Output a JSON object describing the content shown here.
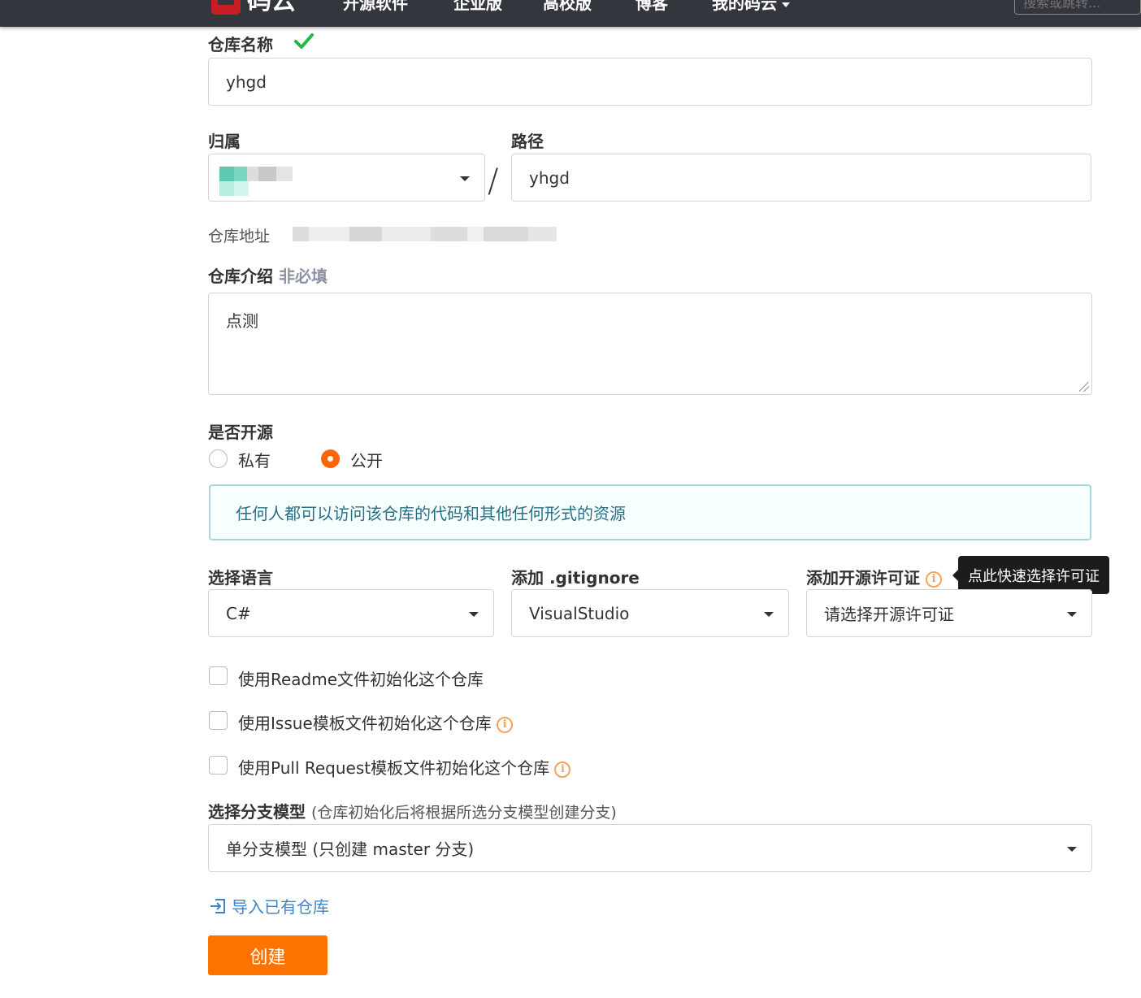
{
  "nav": {
    "logo_text": "码云",
    "items": [
      "开源软件",
      "企业版",
      "高校版",
      "博客",
      "我的码云"
    ],
    "search_placeholder": "搜索或跳转..."
  },
  "form": {
    "repo_name_label": "仓库名称",
    "repo_name_value": "yhgd",
    "owner_label": "归属",
    "path_label": "路径",
    "path_value": "yhgd",
    "path_separator": "/",
    "repo_url_label": "仓库地址",
    "intro_label": "仓库介绍",
    "intro_optional": "非必填",
    "intro_value": "点测",
    "open_label": "是否开源",
    "private_label": "私有",
    "public_label": "公开",
    "public_hint": "任何人都可以访问该仓库的代码和其他任何形式的资源",
    "language_label": "选择语言",
    "language_value": "C#",
    "gitignore_label": "添加 .gitignore",
    "gitignore_value": "VisualStudio",
    "license_label": "添加开源许可证",
    "license_placeholder": "请选择开源许可证",
    "license_tooltip": "点此快速选择许可证",
    "readme_label": "使用Readme文件初始化这个仓库",
    "issue_label": "使用Issue模板文件初始化这个仓库",
    "pr_label": "使用Pull Request模板文件初始化这个仓库",
    "branch_label": "选择分支模型",
    "branch_note": "(仓库初始化后将根据所选分支模型创建分支)",
    "branch_value": "单分支模型 (只创建 master 分支)",
    "import_label": "导入已有仓库",
    "create_label": "创建",
    "info_icon_glyph": "i"
  },
  "colors": {
    "accent": "#fe7300",
    "nav_bg": "#33363d",
    "success": "#21ba45",
    "info_text": "#276f86",
    "link": "#4183c4"
  }
}
